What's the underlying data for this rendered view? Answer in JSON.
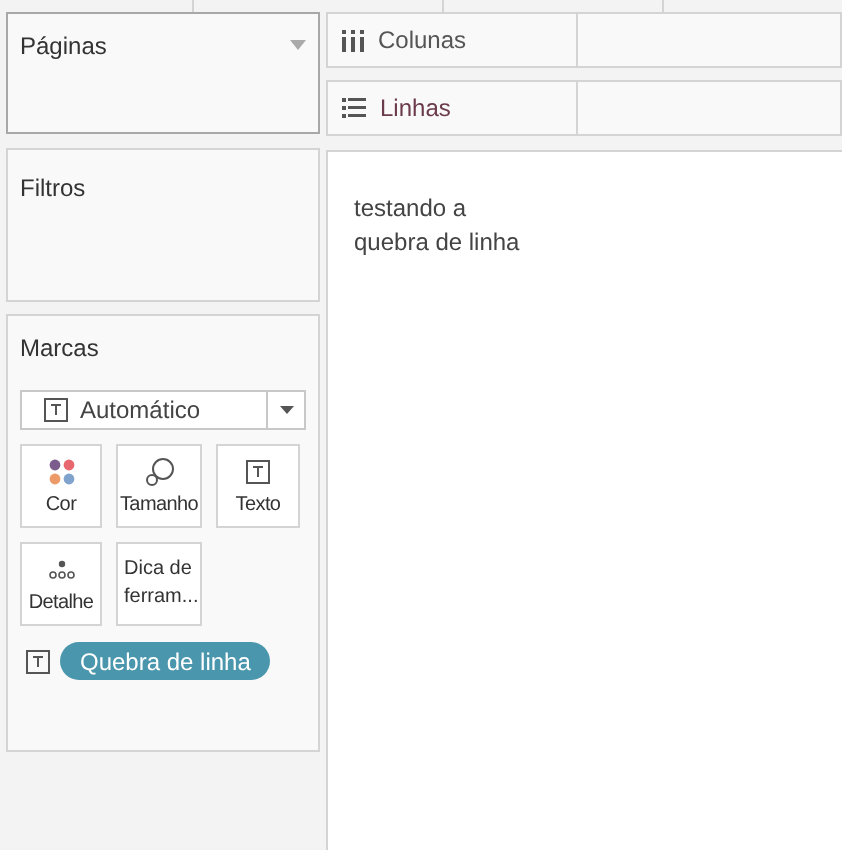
{
  "pages_card": {
    "title": "Páginas"
  },
  "columns_shelf": {
    "label": "Colunas"
  },
  "rows_shelf": {
    "label": "Linhas"
  },
  "filters_card": {
    "title": "Filtros"
  },
  "marks_card": {
    "title": "Marcas",
    "mark_type": "Automático",
    "buttons": [
      {
        "kind": "color",
        "label": "Cor"
      },
      {
        "kind": "size",
        "label": "Tamanho"
      },
      {
        "kind": "text",
        "label": "Texto"
      },
      {
        "kind": "detail",
        "label": "Detalhe"
      },
      {
        "kind": "tooltip",
        "label": "Dica de ferram..."
      }
    ],
    "pill": {
      "label": "Quebra de linha"
    }
  },
  "view": {
    "lines": [
      "testando a",
      "quebra de linha"
    ]
  }
}
